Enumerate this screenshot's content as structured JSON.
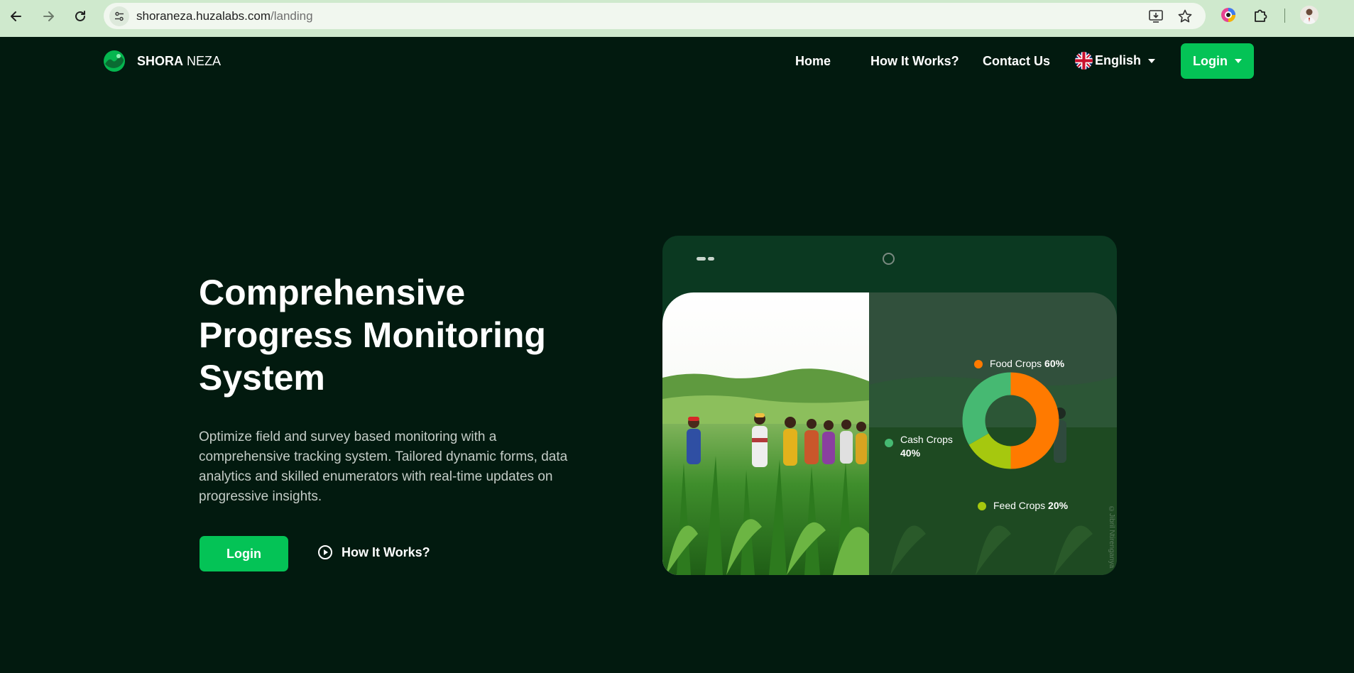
{
  "browser": {
    "url_host": "shoraneza.huzalabs.com",
    "url_path": "/landing"
  },
  "nav": {
    "brand_bold": "SHORA",
    "brand_light": " NEZA",
    "links": [
      "Home",
      "How It Works?",
      "Contact Us"
    ],
    "language": "English",
    "login_label": "Login"
  },
  "hero": {
    "title": "Comprehensive Progress Monitoring System",
    "description": "Optimize field and survey based monitoring with a comprehensive tracking system. Tailored dynamic forms, data analytics and skilled enumerators with real-time updates on progressive insights.",
    "login_label": "Login",
    "how_label": "How It Works?"
  },
  "chart_data": {
    "type": "pie",
    "categories": [
      "Food Crops",
      "Cash Crops",
      "Feed Crops"
    ],
    "values": [
      60,
      40,
      20
    ],
    "labels": [
      "60%",
      "40%",
      "20%"
    ],
    "title": "",
    "colors": [
      "#ff7a00",
      "#46b972",
      "#a6c80e"
    ]
  },
  "photo_watermark": "©Jibril Ntirenganya",
  "colors": {
    "background": "#021a0f",
    "accent": "#04c356",
    "device": "#0b3921"
  },
  "icons": {
    "back": "arrow-left-icon",
    "forward": "arrow-right-icon",
    "reload": "reload-icon",
    "site_info": "tune-icon",
    "install": "install-icon",
    "bookmark": "star-icon",
    "extension_color": "color-picker-icon",
    "extensions": "puzzle-icon",
    "profile": "avatar",
    "language": "uk-flag-icon",
    "play": "play-circle-icon"
  }
}
